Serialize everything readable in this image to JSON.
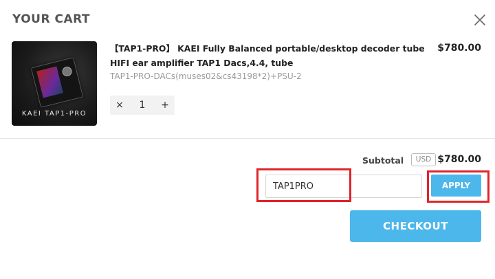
{
  "header": {
    "title": "YOUR CART",
    "close_icon": "close-icon"
  },
  "cart": {
    "items": [
      {
        "image_caption": "KAEI TAP1-PRO",
        "title": "【TAP1-PRO】 KAEI Fully Balanced portable/desktop decoder tube HIFI ear amplifier TAP1 Dacs,4.4, tube",
        "variant": "TAP1-PRO-DACs(muses02&cs43198*2)+PSU-2",
        "quantity": "1",
        "minus_symbol": "×",
        "plus_symbol": "+",
        "price": "$780.00"
      }
    ]
  },
  "summary": {
    "subtotal_label": "Subtotal",
    "currency": "USD",
    "subtotal_value": "$780.00"
  },
  "discount": {
    "value": "TAP1PRO",
    "apply_label": "APPLY"
  },
  "checkout": {
    "label": "CHECKOUT"
  },
  "colors": {
    "accent": "#4cb7ea",
    "highlight": "#e0242a"
  }
}
